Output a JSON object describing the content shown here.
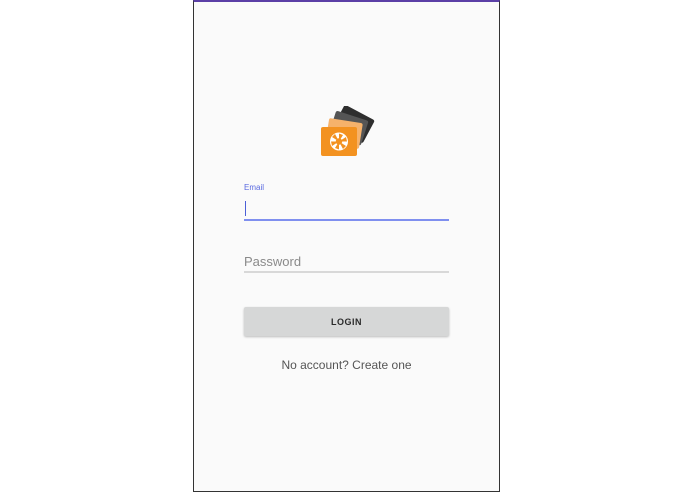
{
  "app": {
    "logo_icon": "photo-cards-aperture-icon",
    "accent_color": "#f39220"
  },
  "login_form": {
    "email_label": "Email",
    "email_value": "",
    "password_placeholder": "Password",
    "login_button_label": "LOGIN",
    "signup_link_label": "No account? Create one"
  }
}
